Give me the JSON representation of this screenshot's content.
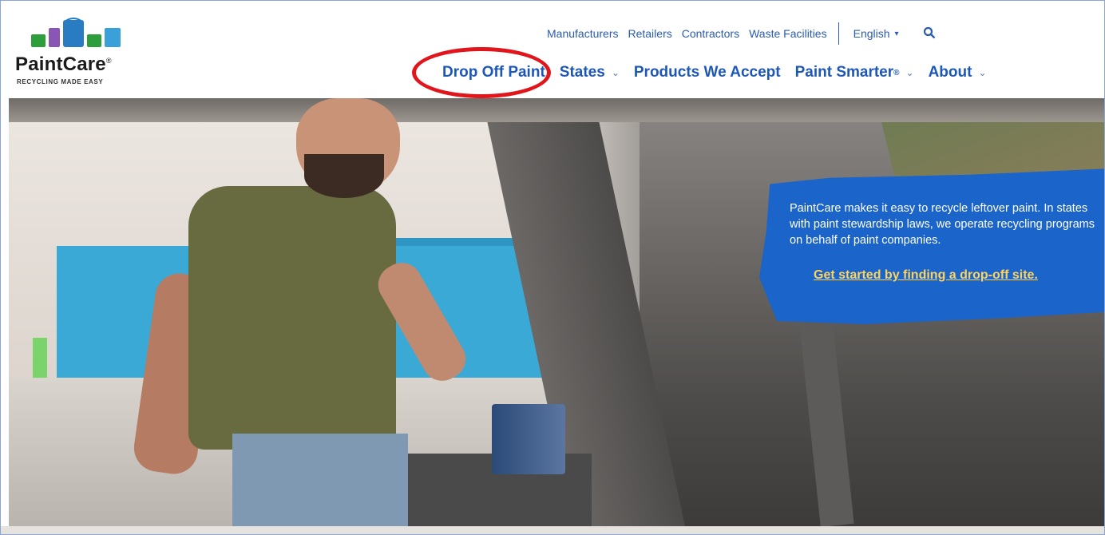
{
  "brand": {
    "name": "PaintCare",
    "registered": "®",
    "tagline": "RECYCLING MADE EASY"
  },
  "utility_nav": {
    "links": [
      "Manufacturers",
      "Retailers",
      "Contractors",
      "Waste Facilities"
    ],
    "language": "English"
  },
  "main_nav": {
    "items": [
      {
        "label": "Drop Off Paint",
        "dropdown": false
      },
      {
        "label": "States",
        "dropdown": true
      },
      {
        "label": "Products We Accept",
        "dropdown": false
      },
      {
        "label": "Paint Smarter",
        "sup": "®",
        "dropdown": true
      },
      {
        "label": "About",
        "dropdown": true
      }
    ]
  },
  "hero": {
    "callout_text": "PaintCare makes it easy to recycle leftover paint. In states with paint stewardship laws, we operate recycling programs on behalf of paint companies.",
    "callout_link": "Get started by finding a drop-off site."
  },
  "colors": {
    "brand_blue": "#1d57b8",
    "highlight_circle": "#e0161c",
    "callout_bg": "#1b64c9",
    "link_yellow": "#ffd35a"
  }
}
